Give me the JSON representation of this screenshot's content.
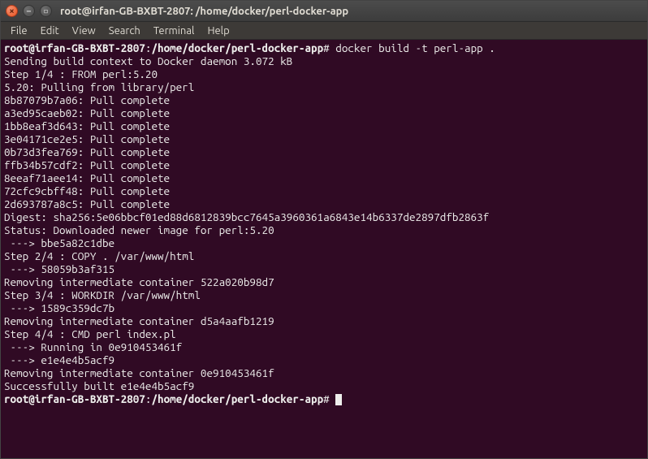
{
  "window": {
    "title": "root@irfan-GB-BXBT-2807: /home/docker/perl-docker-app"
  },
  "menubar": {
    "file": "File",
    "edit": "Edit",
    "view": "View",
    "search": "Search",
    "terminal": "Terminal",
    "help": "Help"
  },
  "prompt": {
    "user_host": "root@irfan-GB-BXBT-2807",
    "path": "/home/docker/perl-docker-app",
    "symbol": "#"
  },
  "command": "docker build -t perl-app .",
  "output": {
    "l1": "Sending build context to Docker daemon 3.072 kB",
    "l2": "Step 1/4 : FROM perl:5.20",
    "l3": "5.20: Pulling from library/perl",
    "l4": "8b87079b7a06: Pull complete",
    "l5": "a3ed95caeb02: Pull complete",
    "l6": "1bb8eaf3d643: Pull complete",
    "l7": "3e04171ce2e5: Pull complete",
    "l8": "0b73d3fea769: Pull complete",
    "l9": "ffb34b57cdf2: Pull complete",
    "l10": "8eeaf71aee14: Pull complete",
    "l11": "72cfc9cbff48: Pull complete",
    "l12": "2d693787a8c5: Pull complete",
    "l13": "Digest: sha256:5e06bbcf01ed88d6812839bcc7645a3960361a6843e14b6337de2897dfb2863f",
    "l14": "Status: Downloaded newer image for perl:5.20",
    "l15": " ---> bbe5a82c1dbe",
    "l16": "Step 2/4 : COPY . /var/www/html",
    "l17": " ---> 58059b3af315",
    "l18": "Removing intermediate container 522a020b98d7",
    "l19": "Step 3/4 : WORKDIR /var/www/html",
    "l20": " ---> 1589c359dc7b",
    "l21": "Removing intermediate container d5a4aafb1219",
    "l22": "Step 4/4 : CMD perl index.pl",
    "l23": " ---> Running in 0e910453461f",
    "l24": " ---> e1e4e4b5acf9",
    "l25": "Removing intermediate container 0e910453461f",
    "l26": "Successfully built e1e4e4b5acf9"
  }
}
